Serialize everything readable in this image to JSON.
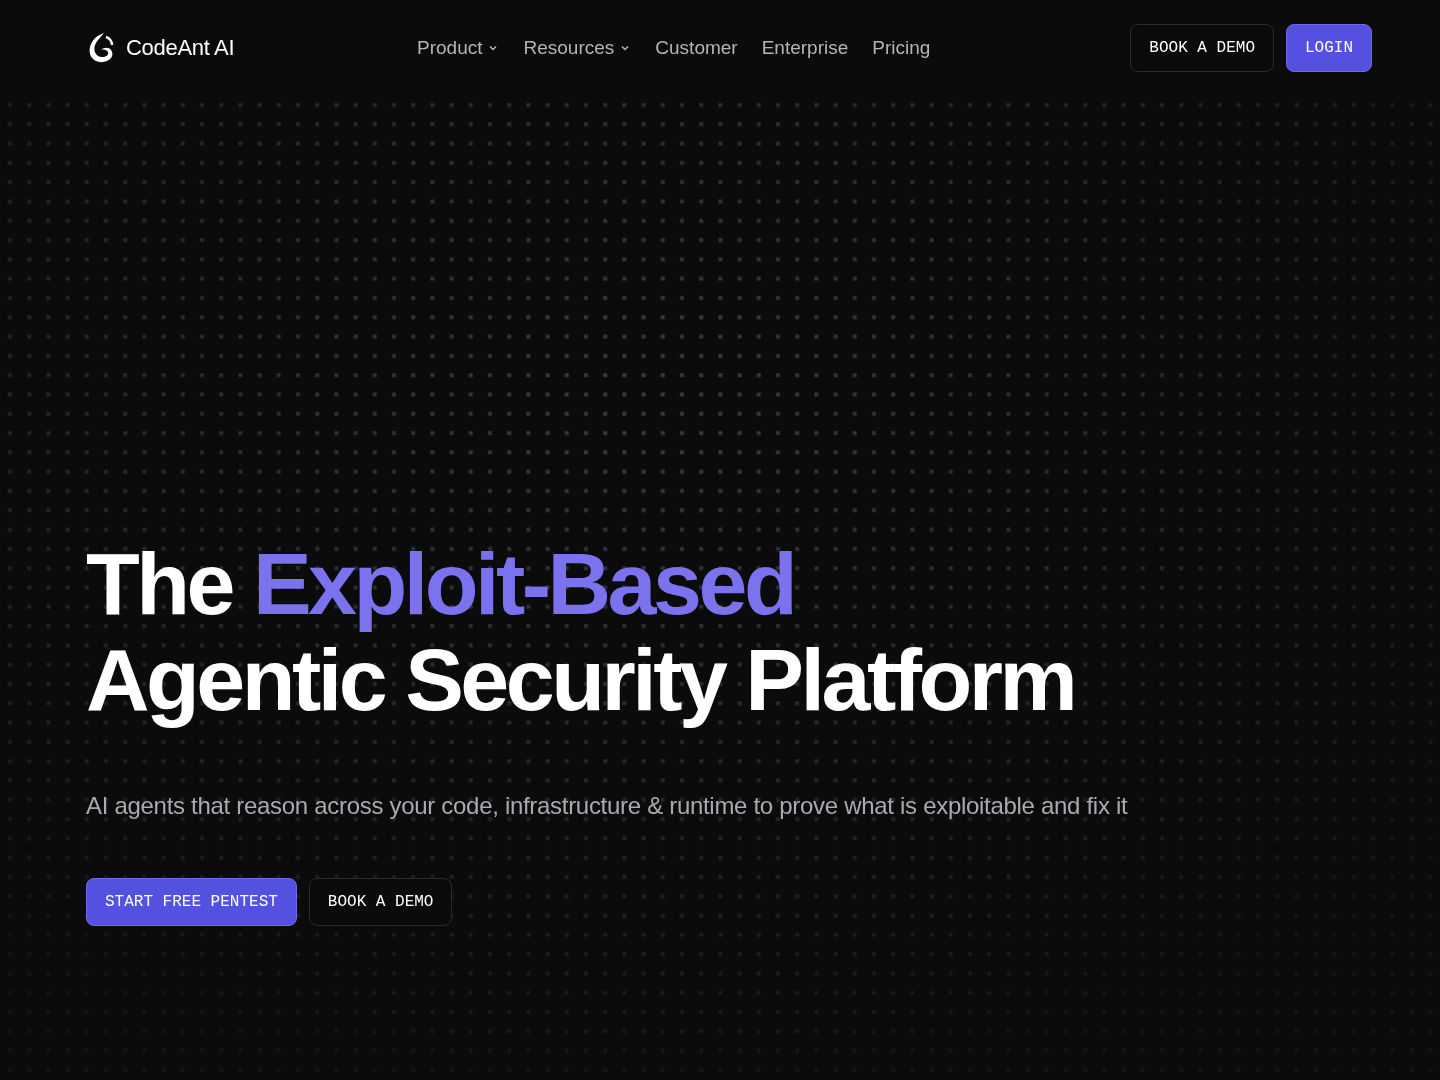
{
  "brand": {
    "name": "CodeAnt AI"
  },
  "nav": [
    {
      "label": "Product",
      "dropdown": true
    },
    {
      "label": "Resources",
      "dropdown": true
    },
    {
      "label": "Customer",
      "dropdown": false
    },
    {
      "label": "Enterprise",
      "dropdown": false
    },
    {
      "label": "Pricing",
      "dropdown": false
    }
  ],
  "header_buttons": [
    {
      "label": "BOOK A DEMO",
      "kind": "outline"
    },
    {
      "label": "LOGIN",
      "kind": "primary"
    }
  ],
  "hero": {
    "title_plain": "The",
    "title_accent": "Exploit-Based",
    "title_line2": "Agentic Security Platform",
    "subtitle": "AI agents that reason across your code, infrastructure & runtime to prove what is exploitable and fix it",
    "buttons": [
      {
        "label": "START FREE PENTEST",
        "kind": "primary"
      },
      {
        "label": "BOOK A DEMO",
        "kind": "outline"
      }
    ]
  }
}
